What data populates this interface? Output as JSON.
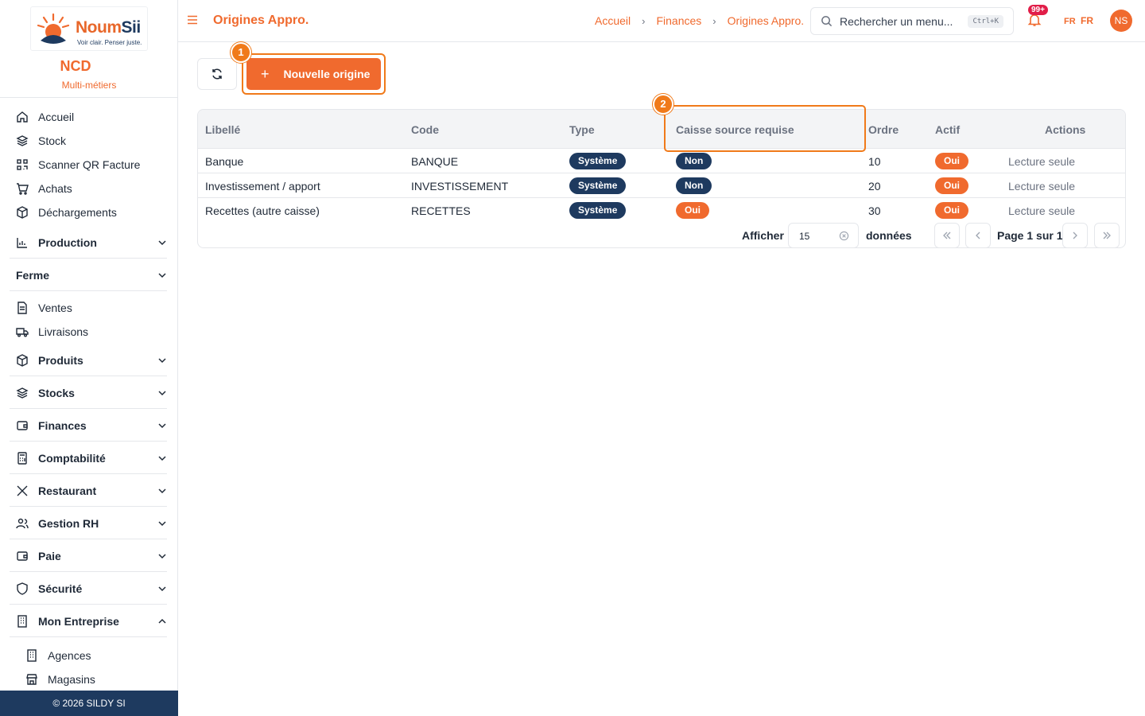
{
  "sidebar": {
    "logo": {
      "name_part1": "Noum",
      "name_part2": "Sii",
      "tagline": "Voir clair. Penser juste."
    },
    "org_name": "NCD",
    "org_sub": "Multi-métiers",
    "items": [
      {
        "label": "Accueil",
        "icon": "home-icon"
      },
      {
        "label": "Stock",
        "icon": "layers-icon"
      },
      {
        "label": "Scanner QR Facture",
        "icon": "qr-icon"
      },
      {
        "label": "Achats",
        "icon": "cart-icon"
      },
      {
        "label": "Déchargements",
        "icon": "box-icon"
      }
    ],
    "groups": [
      {
        "label": "Production",
        "icon": "chart-icon"
      },
      {
        "label": "Ferme",
        "icon": ""
      }
    ],
    "ferme_items": [
      {
        "label": "Ventes",
        "icon": "document-icon"
      },
      {
        "label": "Livraisons",
        "icon": "truck-icon"
      }
    ],
    "groups2": [
      {
        "label": "Produits",
        "icon": "box-icon"
      },
      {
        "label": "Stocks",
        "icon": "layers-icon"
      },
      {
        "label": "Finances",
        "icon": "wallet-icon"
      },
      {
        "label": "Comptabilité",
        "icon": "calculator-icon"
      },
      {
        "label": "Restaurant",
        "icon": "utensils-icon"
      },
      {
        "label": "Gestion RH",
        "icon": "users-icon"
      },
      {
        "label": "Paie",
        "icon": "wallet-icon"
      },
      {
        "label": "Sécurité",
        "icon": "shield-icon"
      },
      {
        "label": "Mon Entreprise",
        "icon": "building-icon"
      }
    ],
    "entreprise_items": [
      {
        "label": "Agences",
        "icon": "building-icon"
      },
      {
        "label": "Magasins",
        "icon": "store-icon"
      }
    ],
    "footer": "© 2026 SILDY SI"
  },
  "header": {
    "title": "Origines Appro.",
    "breadcrumbs": [
      "Accueil",
      "Finances",
      "Origines Appro."
    ],
    "search_placeholder": "Rechercher un menu...",
    "search_shortcut": "Ctrl+K",
    "notif_count": "99+",
    "lang_small": "FR",
    "lang": "FR",
    "avatar": "NS"
  },
  "toolbar": {
    "new_label": "Nouvelle origine",
    "marker1": "1",
    "marker2": "2"
  },
  "table": {
    "columns": [
      "Libellé",
      "Code",
      "Type",
      "Caisse source requise",
      "Ordre",
      "Actif",
      "Actions"
    ],
    "rows": [
      {
        "libelle": "Banque",
        "code": "BANQUE",
        "type": "Système",
        "caisse": "Non",
        "ordre": "10",
        "actif": "Oui",
        "actions": "Lecture seule"
      },
      {
        "libelle": "Investissement / apport",
        "code": "INVESTISSEMENT",
        "type": "Système",
        "caisse": "Non",
        "ordre": "20",
        "actif": "Oui",
        "actions": "Lecture seule"
      },
      {
        "libelle": "Recettes (autre caisse)",
        "code": "RECETTES",
        "type": "Système",
        "caisse": "Oui",
        "ordre": "30",
        "actif": "Oui",
        "actions": "Lecture seule"
      }
    ]
  },
  "pagination": {
    "show_label": "Afficher",
    "page_size": "15",
    "data_label": "données",
    "page_text": "Page 1 sur 1"
  },
  "colors": {
    "accent": "#f06a2e",
    "navy": "#1e3a5f",
    "highlight": "#f07a1a"
  }
}
